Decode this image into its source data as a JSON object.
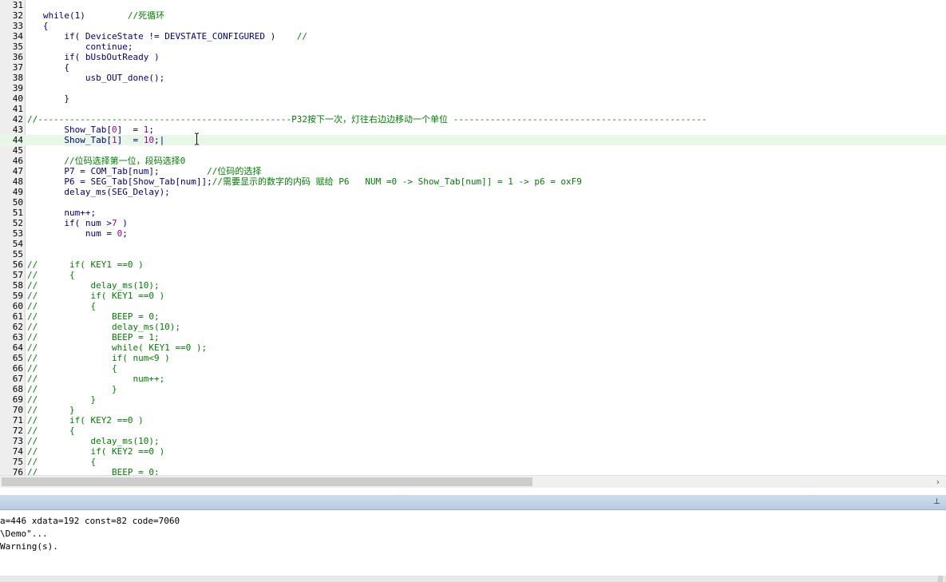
{
  "editor": {
    "lines": [
      {
        "num": "31",
        "segs": []
      },
      {
        "num": "32",
        "segs": [
          {
            "t": "   "
          },
          {
            "t": "while",
            "c": "kw"
          },
          {
            "t": "(1)        "
          },
          {
            "t": "//死循环",
            "c": "cm"
          }
        ]
      },
      {
        "num": "33",
        "segs": [
          {
            "t": "   {"
          }
        ]
      },
      {
        "num": "34",
        "segs": [
          {
            "t": "       "
          },
          {
            "t": "if",
            "c": "kw"
          },
          {
            "t": "( DeviceState != DEVSTATE_CONFIGURED )    "
          },
          {
            "t": "//",
            "c": "cm"
          }
        ]
      },
      {
        "num": "35",
        "segs": [
          {
            "t": "           "
          },
          {
            "t": "continue",
            "c": "kw"
          },
          {
            "t": ";"
          }
        ]
      },
      {
        "num": "36",
        "segs": [
          {
            "t": "       "
          },
          {
            "t": "if",
            "c": "kw"
          },
          {
            "t": "( bUsbOutReady )"
          }
        ]
      },
      {
        "num": "37",
        "segs": [
          {
            "t": "       {"
          }
        ]
      },
      {
        "num": "38",
        "segs": [
          {
            "t": "           usb_OUT_done();"
          }
        ]
      },
      {
        "num": "39",
        "segs": []
      },
      {
        "num": "40",
        "segs": [
          {
            "t": "       }"
          }
        ]
      },
      {
        "num": "41",
        "segs": []
      },
      {
        "num": "42",
        "segs": [
          {
            "t": "//------------------------------------------------P32按下一次，灯往右边边移动一个单位 ------------------------------------------------",
            "c": "cm"
          }
        ]
      },
      {
        "num": "43",
        "segs": [
          {
            "t": "       Show_Tab["
          },
          {
            "t": "0",
            "c": "num"
          },
          {
            "t": "]  = "
          },
          {
            "t": "1",
            "c": "num"
          },
          {
            "t": ";"
          }
        ]
      },
      {
        "num": "44",
        "segs": [
          {
            "t": "       Show_Tab["
          },
          {
            "t": "1",
            "c": "num"
          },
          {
            "t": "]  = "
          },
          {
            "t": "10",
            "c": "num"
          },
          {
            "t": ";|"
          }
        ],
        "current": true
      },
      {
        "num": "45",
        "segs": []
      },
      {
        "num": "46",
        "segs": [
          {
            "t": "       "
          },
          {
            "t": "//位码选择第一位，段码选择0",
            "c": "cm"
          }
        ]
      },
      {
        "num": "47",
        "segs": [
          {
            "t": "       P7 = COM_Tab[num];         "
          },
          {
            "t": "//位码的选择",
            "c": "cm"
          }
        ]
      },
      {
        "num": "48",
        "segs": [
          {
            "t": "       P6 = SEG_Tab[Show_Tab[num]];"
          },
          {
            "t": "//需要显示的数字的内码 赋给 P6   NUM =0 -> Show_Tab[num]] = 1 -> p6 = oxF9",
            "c": "cm"
          }
        ]
      },
      {
        "num": "49",
        "segs": [
          {
            "t": "       delay_ms(SEG_Delay);"
          }
        ]
      },
      {
        "num": "50",
        "segs": []
      },
      {
        "num": "51",
        "segs": [
          {
            "t": "       num++;"
          }
        ]
      },
      {
        "num": "52",
        "segs": [
          {
            "t": "       "
          },
          {
            "t": "if",
            "c": "kw"
          },
          {
            "t": "( num >"
          },
          {
            "t": "7",
            "c": "num"
          },
          {
            "t": " )"
          }
        ]
      },
      {
        "num": "53",
        "segs": [
          {
            "t": "           num = "
          },
          {
            "t": "0",
            "c": "num"
          },
          {
            "t": ";"
          }
        ]
      },
      {
        "num": "54",
        "segs": []
      },
      {
        "num": "55",
        "segs": []
      },
      {
        "num": "56",
        "segs": [
          {
            "t": "//      if( KEY1 ==0 )",
            "c": "cm"
          }
        ]
      },
      {
        "num": "57",
        "segs": [
          {
            "t": "//      {",
            "c": "cm"
          }
        ]
      },
      {
        "num": "58",
        "segs": [
          {
            "t": "//          delay_ms(10);",
            "c": "cm"
          }
        ]
      },
      {
        "num": "59",
        "segs": [
          {
            "t": "//          if( KEY1 ==0 )",
            "c": "cm"
          }
        ]
      },
      {
        "num": "60",
        "segs": [
          {
            "t": "//          {",
            "c": "cm"
          }
        ]
      },
      {
        "num": "61",
        "segs": [
          {
            "t": "//              BEEP = 0;",
            "c": "cm"
          }
        ]
      },
      {
        "num": "62",
        "segs": [
          {
            "t": "//              delay_ms(10);",
            "c": "cm"
          }
        ]
      },
      {
        "num": "63",
        "segs": [
          {
            "t": "//              BEEP = 1;",
            "c": "cm"
          }
        ]
      },
      {
        "num": "64",
        "segs": [
          {
            "t": "//              while( KEY1 ==0 );",
            "c": "cm"
          }
        ]
      },
      {
        "num": "65",
        "segs": [
          {
            "t": "//              if( num<9 )",
            "c": "cm"
          }
        ]
      },
      {
        "num": "66",
        "segs": [
          {
            "t": "//              {",
            "c": "cm"
          }
        ]
      },
      {
        "num": "67",
        "segs": [
          {
            "t": "//                  num++;",
            "c": "cm"
          }
        ]
      },
      {
        "num": "68",
        "segs": [
          {
            "t": "//              }",
            "c": "cm"
          }
        ]
      },
      {
        "num": "69",
        "segs": [
          {
            "t": "//          }",
            "c": "cm"
          }
        ]
      },
      {
        "num": "70",
        "segs": [
          {
            "t": "//      }",
            "c": "cm"
          }
        ]
      },
      {
        "num": "71",
        "segs": [
          {
            "t": "//      if( KEY2 ==0 )",
            "c": "cm"
          }
        ]
      },
      {
        "num": "72",
        "segs": [
          {
            "t": "//      {",
            "c": "cm"
          }
        ]
      },
      {
        "num": "73",
        "segs": [
          {
            "t": "//          delay_ms(10);",
            "c": "cm"
          }
        ]
      },
      {
        "num": "74",
        "segs": [
          {
            "t": "//          if( KEY2 ==0 )",
            "c": "cm"
          }
        ]
      },
      {
        "num": "75",
        "segs": [
          {
            "t": "//          {",
            "c": "cm"
          }
        ]
      },
      {
        "num": "76",
        "segs": [
          {
            "t": "//              BEEP = 0;",
            "c": "cm"
          }
        ]
      }
    ]
  },
  "scrollbar": {
    "right_arrow": "›"
  },
  "panel": {
    "pin_glyph": "⊥"
  },
  "output": {
    "lines": [
      "a=446 xdata=192 const=82 code=7060",
      "\\Demo\"...",
      "Warning(s)."
    ]
  },
  "colors": {
    "current_line": "#e8f8e8",
    "comment": "#008000",
    "keyword": "#00008b",
    "number": "#a000a0",
    "panel_bar": "#c4d4e8"
  },
  "icons": {
    "cursor": "ibeam-cursor-icon",
    "scroll_right": "chevron-right-icon",
    "pin": "pin-icon"
  }
}
